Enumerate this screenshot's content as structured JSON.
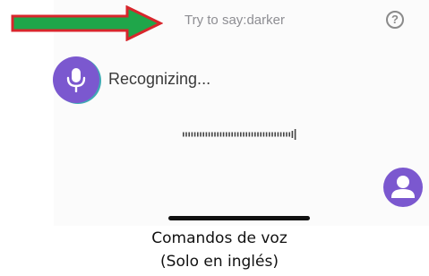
{
  "colors": {
    "accent_purple": "#7b58cf",
    "arrow_fill": "#1fa64a",
    "arrow_outline": "#d8262c"
  },
  "header": {
    "hint_text": "Try to say:darker",
    "help_icon": "question-circle-icon",
    "help_glyph": "?"
  },
  "voice": {
    "mic_icon": "microphone-icon",
    "status_text": "Recognizing..."
  },
  "user_icon": "person-icon",
  "caption": {
    "line1": "Comandos de voz",
    "line2": "(Solo en inglés)"
  }
}
